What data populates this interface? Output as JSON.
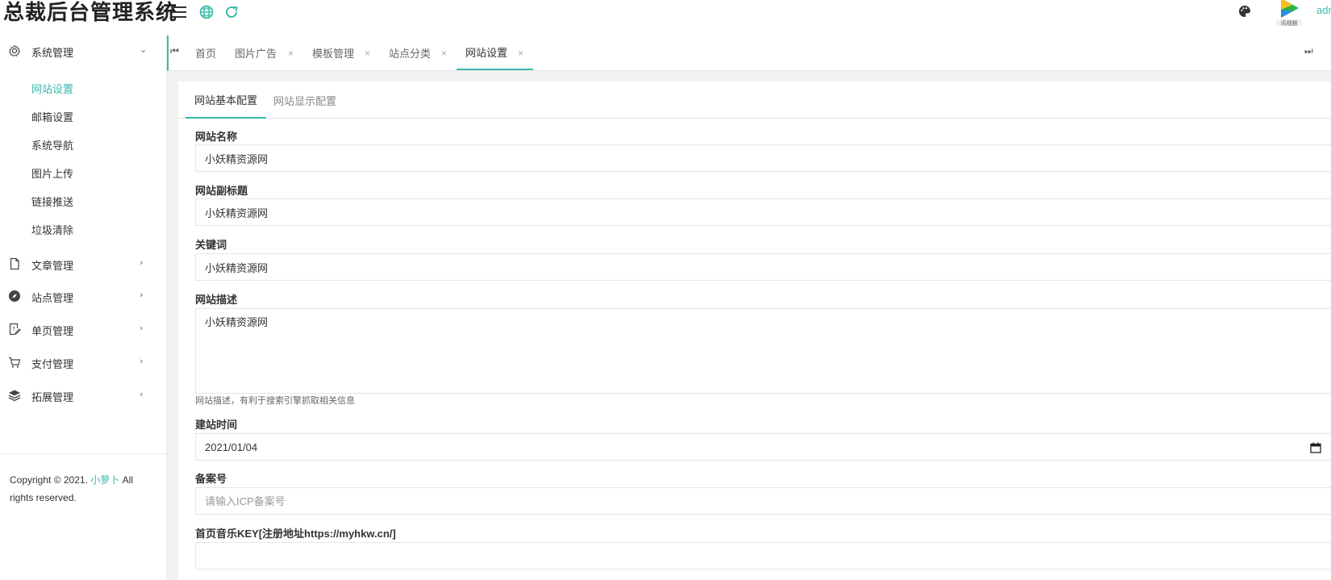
{
  "header": {
    "brand": "总裁后台管理系统",
    "admin_name": "adm",
    "colors": {
      "accent": "#3ab8ac"
    },
    "icons": [
      "menu-fold-icon",
      "globe-icon",
      "refresh-icon",
      "theme-palette-icon"
    ]
  },
  "sidebar": {
    "groups": [
      {
        "label": "系统管理",
        "icon": "gear-icon",
        "expanded": true
      },
      {
        "label": "文章管理",
        "icon": "file-icon",
        "expanded": false
      },
      {
        "label": "站点管理",
        "icon": "compass-icon",
        "expanded": false
      },
      {
        "label": "单页管理",
        "icon": "page-edit-icon",
        "expanded": false
      },
      {
        "label": "支付管理",
        "icon": "cart-icon",
        "expanded": false
      },
      {
        "label": "拓展管理",
        "icon": "layers-icon",
        "expanded": false
      }
    ],
    "submenu": [
      {
        "label": "网站设置",
        "active": true
      },
      {
        "label": "邮箱设置",
        "active": false
      },
      {
        "label": "系统导航",
        "active": false
      },
      {
        "label": "图片上传",
        "active": false
      },
      {
        "label": "链接推送",
        "active": false
      },
      {
        "label": "垃圾清除",
        "active": false
      }
    ],
    "copyright": {
      "prefix": "Copyright © 2021. ",
      "link": "小萝卜",
      "suffix": " All rights reserved."
    }
  },
  "tabbar": {
    "tabs": [
      {
        "label": "首页",
        "closable": false,
        "active": false
      },
      {
        "label": "图片广告",
        "closable": true,
        "active": false
      },
      {
        "label": "模板管理",
        "closable": true,
        "active": false
      },
      {
        "label": "站点分类",
        "closable": true,
        "active": false
      },
      {
        "label": "网站设置",
        "closable": true,
        "active": true
      }
    ],
    "close_glyph": "×",
    "prev_glyph": "⏮",
    "next_glyph": "⏭"
  },
  "form": {
    "subtabs": [
      {
        "label": "网站基本配置",
        "active": true
      },
      {
        "label": "网站显示配置",
        "active": false
      }
    ],
    "site_name": {
      "label": "网站名称",
      "value": "小妖精资源网"
    },
    "subtitle": {
      "label": "网站副标题",
      "value": "小妖精资源网"
    },
    "keywords": {
      "label": "关键词",
      "value": "小妖精资源网"
    },
    "description": {
      "label": "网站描述",
      "value": "小妖精资源网",
      "help": "网站描述，有利于搜索引擎抓取相关信息"
    },
    "build_date": {
      "label": "建站时间",
      "value": "2021/01/04"
    },
    "icp": {
      "label": "备案号",
      "placeholder": "请输入ICP备案号"
    },
    "music_key": {
      "label": "首页音乐KEY[注册地址https://myhkw.cn/]"
    }
  }
}
